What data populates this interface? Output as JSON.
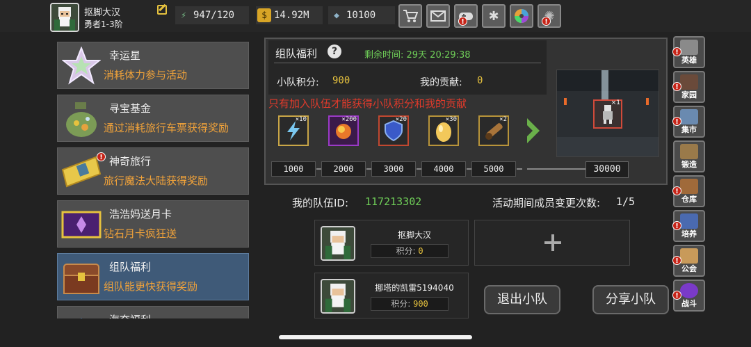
{
  "player": {
    "name": "抠脚大汉",
    "rank": "勇者1-3阶"
  },
  "resources": {
    "energy": "947/120",
    "gold": "14.92M",
    "gems": "10100"
  },
  "colors": {
    "accent_green": "#6fce58",
    "accent_gold": "#e6c23e",
    "warning_red": "#e13a2b",
    "desc_orange": "#f0a23a",
    "active_blue": "#3f5a78"
  },
  "toolbar": {
    "icons": [
      "shop-icon",
      "mail-icon",
      "gamepad-icon",
      "settings-gear-icon",
      "color-wheel-icon",
      "burst-icon"
    ]
  },
  "menu": {
    "items": [
      {
        "title": "幸运星",
        "desc": "消耗体力参与活动"
      },
      {
        "title": "寻宝基金",
        "desc": "通过消耗旅行车票获得奖励"
      },
      {
        "title": "神奇旅行",
        "desc": "旅行魔法大陆获得奖励"
      },
      {
        "title": "浩浩妈送月卡",
        "desc": "钻石月卡疯狂送"
      },
      {
        "title": "组队福利",
        "desc": "组队能更快获得奖励"
      },
      {
        "title": "海夺福利",
        "desc": ""
      }
    ],
    "active_index": 4
  },
  "panel": {
    "title": "组队福利",
    "timer_label": "剩余时间: 29天 20:29:38",
    "team_score_label": "小队积分:",
    "team_score": "900",
    "contribution_label": "我的贡献:",
    "contribution": "0",
    "warning": "只有加入队伍才能获得小队积分和我的贡献",
    "rewards": [
      {
        "qty": "×10",
        "icon": "lightning-scroll-icon"
      },
      {
        "qty": "×200",
        "icon": "fire-orb-icon"
      },
      {
        "qty": "×20",
        "icon": "blue-shield-icon"
      },
      {
        "qty": "×30",
        "icon": "golden-egg-icon"
      },
      {
        "qty": "×2",
        "icon": "cannon-icon"
      }
    ],
    "milestones": [
      "1000",
      "2000",
      "3000",
      "4000",
      "5000"
    ],
    "final_milestone": "30000",
    "final_reward_qty": "×1"
  },
  "team": {
    "id_label": "我的队伍ID:",
    "id": "117213302",
    "change_label": "活动期间成员变更次数:",
    "change_count": "1/5",
    "score_label": "积分:",
    "members": [
      {
        "name": "抠脚大汉",
        "score": "0"
      },
      {
        "name": "挪塔的凯雷5194040",
        "score": "900"
      }
    ],
    "leave_button": "退出小队",
    "share_button": "分享小队"
  },
  "right_nav": {
    "items": [
      {
        "label": "英雄",
        "icon": "hero-helmet-icon",
        "badge": true
      },
      {
        "label": "家园",
        "icon": "home-castle-icon",
        "badge": true
      },
      {
        "label": "集市",
        "icon": "market-stall-icon",
        "badge": true
      },
      {
        "label": "锻造",
        "icon": "anvil-hammer-icon",
        "badge": false
      },
      {
        "label": "仓库",
        "icon": "warehouse-icon",
        "badge": true
      },
      {
        "label": "培养",
        "icon": "training-sword-icon",
        "badge": true
      },
      {
        "label": "公会",
        "icon": "guild-icon",
        "badge": true
      },
      {
        "label": "战斗",
        "icon": "battle-portal-icon",
        "badge": true
      }
    ]
  }
}
